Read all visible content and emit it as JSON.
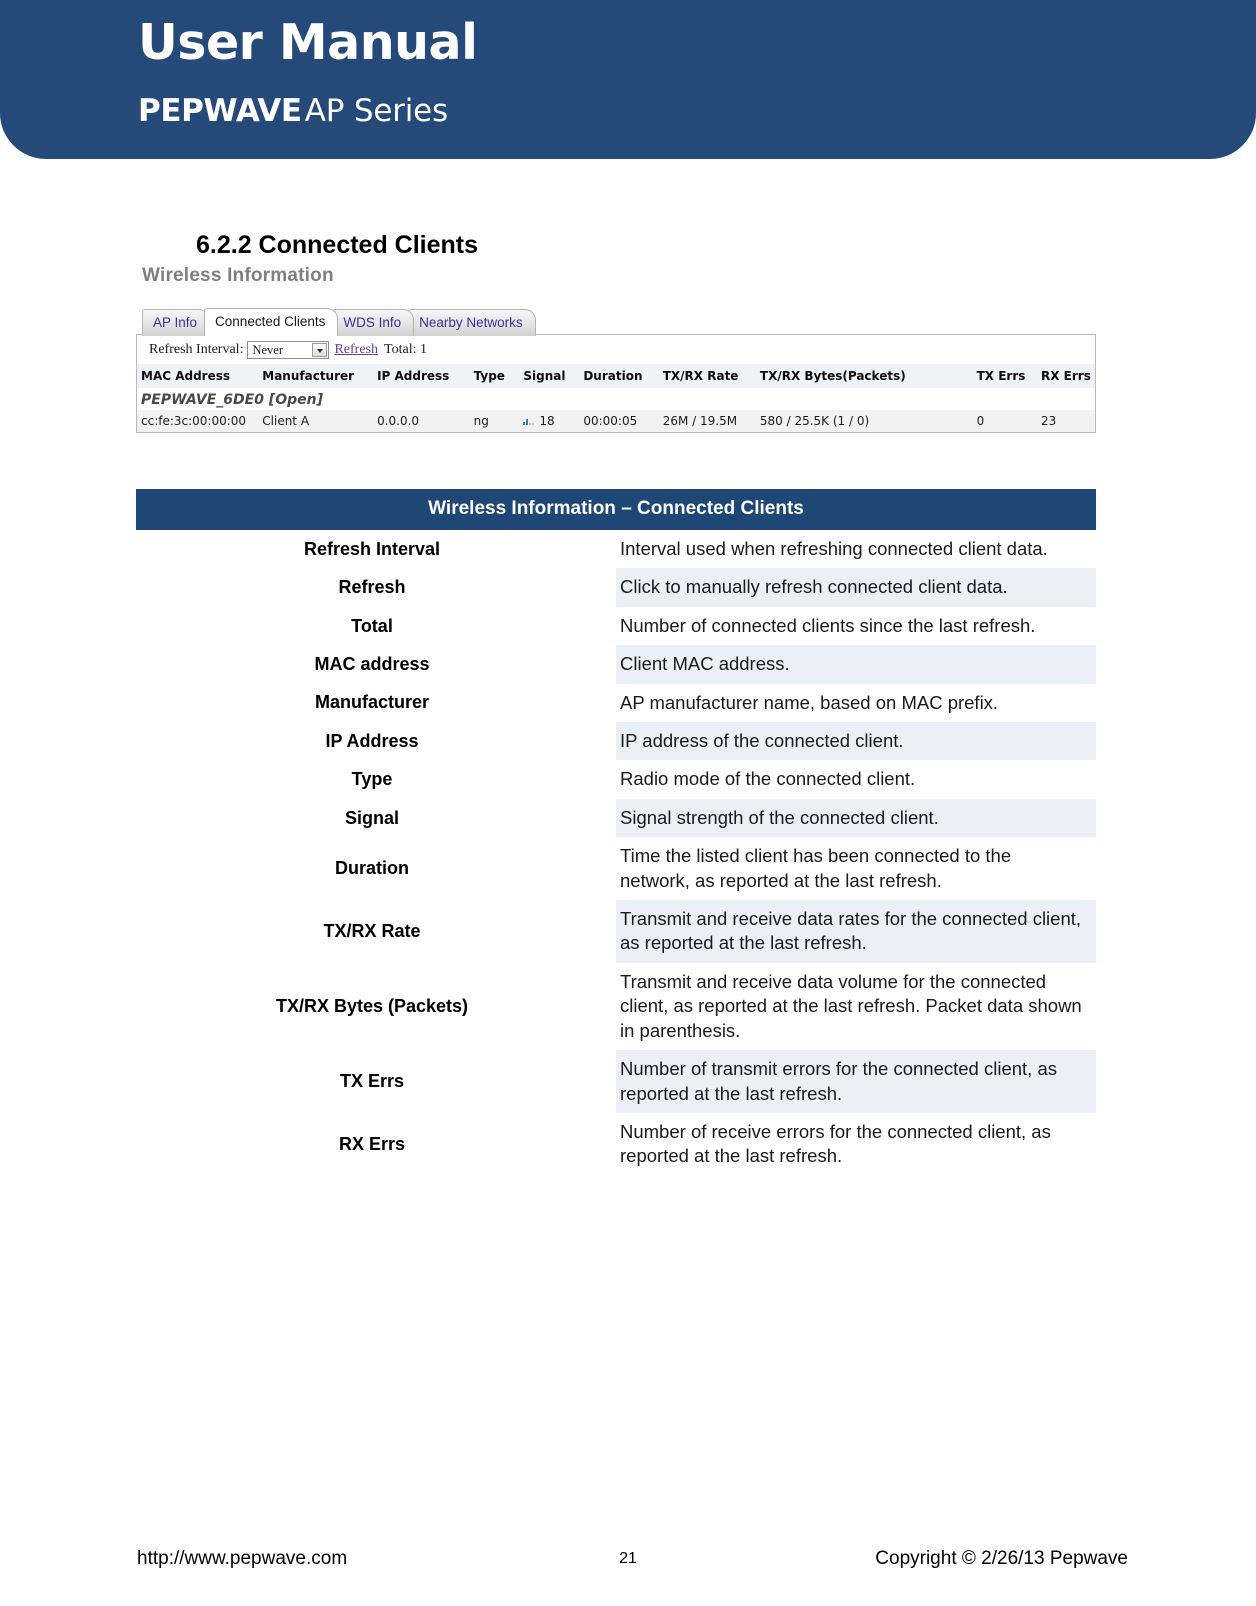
{
  "banner": {
    "title": "User Manual",
    "brand": "PEPWAVE",
    "series": "AP Series",
    "bg_color": "#254a79"
  },
  "section": {
    "heading": "6.2.2 Connected Clients"
  },
  "screenshot": {
    "title": "Wireless Information",
    "tabs": [
      {
        "label": "AP Info",
        "active": false
      },
      {
        "label": "Connected Clients",
        "active": true
      },
      {
        "label": "WDS Info",
        "active": false
      },
      {
        "label": "Nearby Networks",
        "active": false
      }
    ],
    "toolbar": {
      "refresh_interval_label": "Refresh Interval:",
      "refresh_interval_value": "Never",
      "refresh_link": "Refresh",
      "total_label": "Total: 1"
    },
    "table": {
      "columns": [
        "MAC Address",
        "Manufacturer",
        "IP Address",
        "Type",
        "Signal",
        "Duration",
        "TX/RX Rate",
        "TX/RX Bytes(Packets)",
        "TX Errs",
        "RX Errs"
      ],
      "ssid_row": "PEPWAVE_6DE0 [Open]",
      "rows": [
        {
          "mac": "cc:fe:3c:00:00:00",
          "manufacturer": "Client A",
          "ip": "0.0.0.0",
          "type": "ng",
          "signal_icon": "signal-bars-icon",
          "signal": "18",
          "duration": "00:00:05",
          "rate": "26M / 19.5M",
          "bytes": "580 / 25.5K (1 / 0)",
          "tx_errs": "0",
          "rx_errs": "23"
        }
      ]
    }
  },
  "desc_table": {
    "header": "Wireless Information – Connected Clients",
    "header_bg": "#1f4776",
    "alt_row_bg": "#eaeff8",
    "rows": [
      {
        "key": "Refresh Interval",
        "value": "Interval used when refreshing connected client data."
      },
      {
        "key": "Refresh",
        "value": "Click to manually refresh connected client data."
      },
      {
        "key": "Total",
        "value": "Number of connected clients since the last refresh."
      },
      {
        "key": "MAC address",
        "value": "Client MAC address."
      },
      {
        "key": "Manufacturer",
        "value": "AP manufacturer name, based on MAC prefix."
      },
      {
        "key": "IP Address",
        "value": "IP address of the connected client."
      },
      {
        "key": "Type",
        "value": "Radio mode of the connected client."
      },
      {
        "key": "Signal",
        "value": "Signal strength of the connected client."
      },
      {
        "key": "Duration",
        "value": "Time the listed client has been connected to the network, as reported at the last refresh."
      },
      {
        "key": "TX/RX Rate",
        "value": "Transmit and receive data rates for the connected client, as reported at the last refresh."
      },
      {
        "key": "TX/RX Bytes (Packets)",
        "value": "Transmit and receive data volume for the connected client, as reported at the last refresh. Packet data shown in parenthesis."
      },
      {
        "key": "TX Errs",
        "value": "Number of transmit errors for the connected client, as reported at the last refresh."
      },
      {
        "key": "RX Errs",
        "value": "Number of receive errors for the connected client, as reported at the last refresh."
      }
    ]
  },
  "footer": {
    "url": "http://www.pepwave.com",
    "page_number": "21",
    "copyright": "Copyright © 2/26/13 Pepwave"
  }
}
